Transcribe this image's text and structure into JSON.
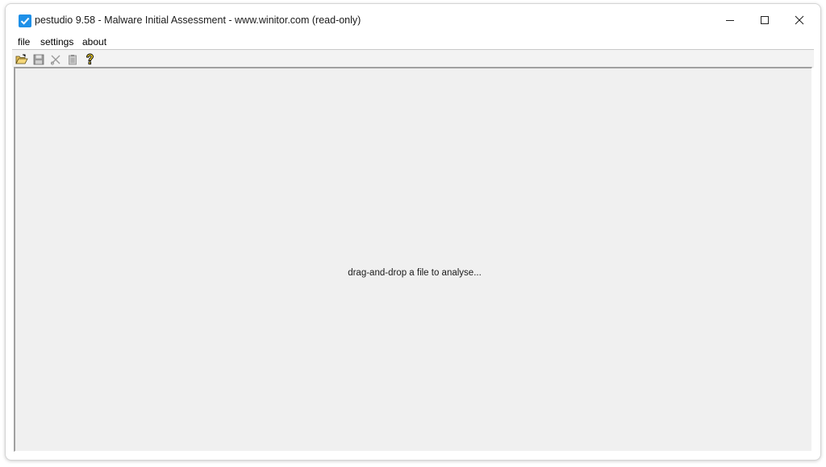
{
  "window": {
    "title": "pestudio 9.58 - Malware Initial Assessment - www.winitor.com (read-only)",
    "app_icon": "checkbox-icon",
    "controls": [
      "minimize-icon",
      "maximize-icon",
      "close-icon"
    ]
  },
  "menu": {
    "file": "file",
    "settings": "settings",
    "about": "about"
  },
  "toolbar": {
    "icons": [
      "open-folder-icon",
      "save-icon",
      "cut-icon",
      "clipboard-icon",
      "help-icon"
    ]
  },
  "main": {
    "hint": "drag-and-drop a file to analyse..."
  },
  "colors": {
    "accent": "#1e90e8",
    "panel_bg": "#f0f0f0",
    "close_hover": "#e81123"
  }
}
